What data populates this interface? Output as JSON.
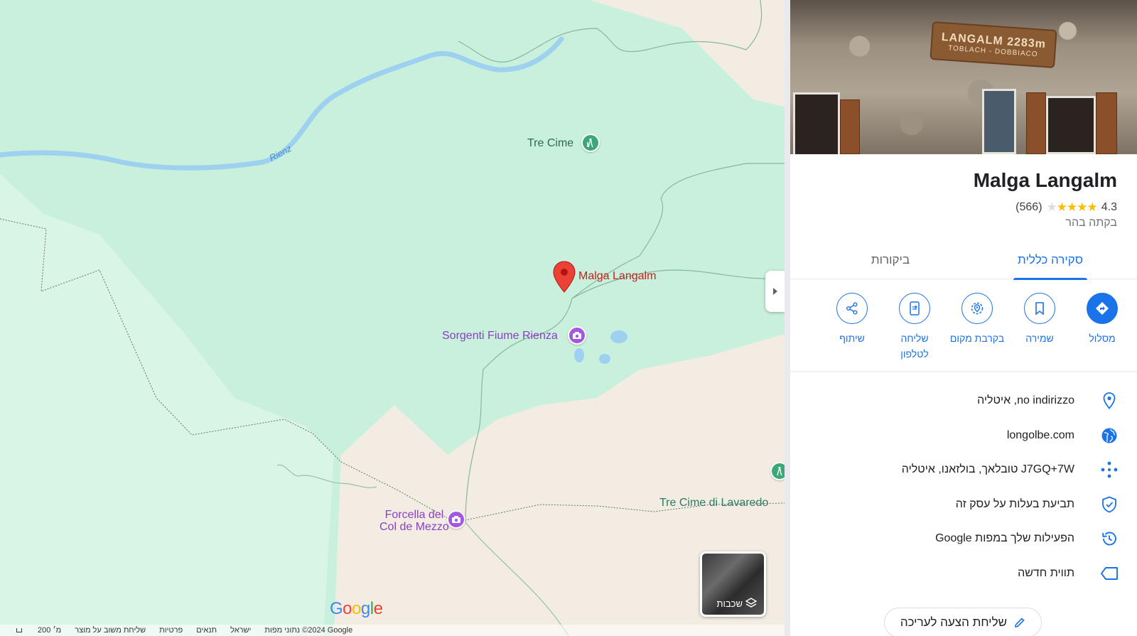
{
  "map": {
    "labels": {
      "tre_cime": "Tre Cime",
      "rienz": "Rienz",
      "malga_langalm": "Malga Langalm",
      "sorgenti": "Sorgenti Fiume Rienza",
      "forcella_line1": "Forcella del",
      "forcella_line2": "Col de Mezzo",
      "tre_cime_lavaredo": "Tre Cime di Lavaredo"
    },
    "layers_label": "שכבות",
    "google_logo": [
      "G",
      "o",
      "o",
      "g",
      "l",
      "e"
    ],
    "footer": {
      "map_data": "נתוני מפות ‎©2024 Google",
      "country": "ישראל",
      "terms": "תנאים",
      "privacy": "פרטיות",
      "feedback": "שליחת משוב על מוצר",
      "scale": "200 מ׳"
    }
  },
  "panel": {
    "photo_sign_line1": "LANGALM 2283m",
    "photo_sign_line2": "TOBLACH - DOBBIACO",
    "title": "Malga Langalm",
    "rating": "4.3",
    "stars": 4.3,
    "review_count": "(566)",
    "category": "בקתה בהר",
    "tabs": [
      {
        "label": "סקירה כללית",
        "active": true
      },
      {
        "label": "ביקורות",
        "active": false
      }
    ],
    "actions": [
      {
        "label": "מסלול",
        "icon": "directions-icon"
      },
      {
        "label": "שמירה",
        "icon": "bookmark-icon"
      },
      {
        "label": "בקרבת מקום",
        "icon": "nearby-icon"
      },
      {
        "label": "שליחה\nלטלפון",
        "label_line1": "שליחה",
        "label_line2": "לטלפון",
        "icon": "send-to-phone-icon"
      },
      {
        "label": "שיתוף",
        "icon": "share-icon"
      }
    ],
    "info": [
      {
        "text": "no indirizzo, איטליה",
        "icon": "location-pin-icon"
      },
      {
        "text": "longolbe.com",
        "icon": "globe-icon"
      },
      {
        "text": "J7GQ+7W טובלאך, בולזאנו, איטליה",
        "icon": "plus-code-icon"
      },
      {
        "text": "תביעת בעלות על עסק זה",
        "icon": "shield-check-icon"
      },
      {
        "text": "הפעילות שלך במפות Google",
        "icon": "history-icon"
      },
      {
        "text": "תווית חדשה",
        "icon": "label-icon"
      }
    ],
    "suggest_edit": "שליחת הצעה לעריכה"
  },
  "colors": {
    "accent": "#1a73e8",
    "marker_red": "#d93025",
    "park_green": "#c9f0dc",
    "star": "#fbbc04"
  }
}
